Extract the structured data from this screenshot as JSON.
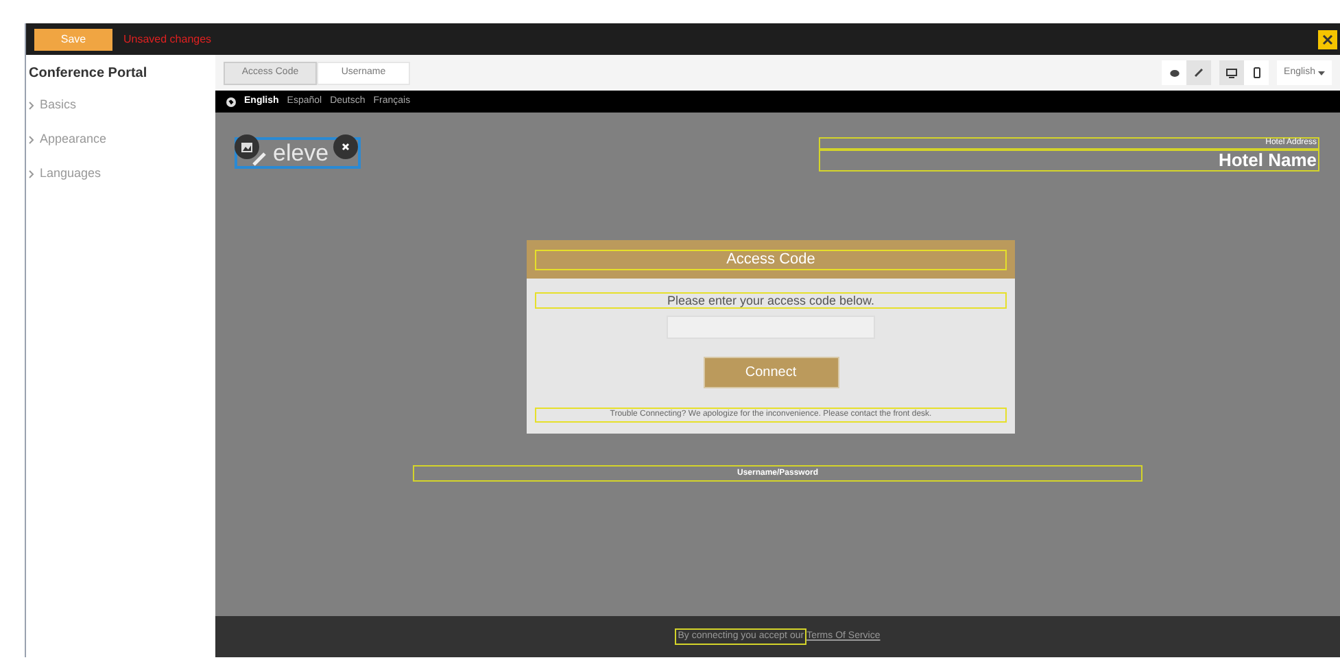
{
  "top_bar": {
    "save_button": "Save",
    "status": "Unsaved changes"
  },
  "sidebar": {
    "title": "Conference Portal",
    "items": [
      {
        "label": "Basics"
      },
      {
        "label": "Appearance"
      },
      {
        "label": "Languages"
      }
    ]
  },
  "editor_tabs": [
    {
      "label": "Access Code",
      "selected": true
    },
    {
      "label": "Username",
      "selected": false
    }
  ],
  "view_modes": [
    {
      "kind": "preview",
      "selected": false
    },
    {
      "kind": "edit",
      "selected": true
    }
  ],
  "devices": [
    {
      "kind": "desktop",
      "selected": true
    },
    {
      "kind": "mobile",
      "selected": false
    }
  ],
  "language_dropdown": "English",
  "preview": {
    "languages": [
      {
        "label": "English",
        "selected": true
      },
      {
        "label": "Español",
        "selected": false
      },
      {
        "label": "Deutsch",
        "selected": false
      },
      {
        "label": "Français",
        "selected": false
      }
    ],
    "logo_text": "eleve",
    "hotel_address": "Hotel Address",
    "hotel_name": "Hotel Name",
    "access_card": {
      "title": "Access Code",
      "prompt": "Please enter your access code below.",
      "button": "Connect",
      "help": "Trouble Connecting? We apologize for the inconvenience. Please contact the front desk."
    },
    "username_section": "Username/Password",
    "footer": {
      "terms_prefix": "By connecting you accept our",
      "terms_link": "Terms Of Service"
    }
  }
}
